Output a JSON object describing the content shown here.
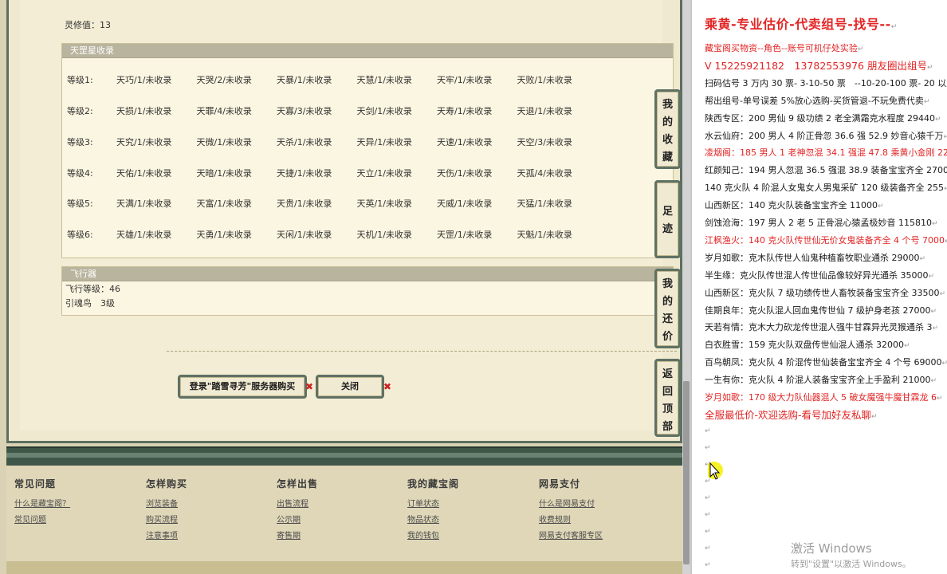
{
  "game": {
    "lingxiu_label": "灵修值：13",
    "stars_header": "天罡星收录",
    "star_rows": [
      {
        "level": "等级1:",
        "cells": [
          "天巧/1/未收录",
          "天哭/2/未收录",
          "天暴/1/未收录",
          "天慧/1/未收录",
          "天牢/1/未收录",
          "天败/1/未收录"
        ]
      },
      {
        "level": "等级2:",
        "cells": [
          "天损/1/未收录",
          "天罪/4/未收录",
          "天寡/3/未收录",
          "天剑/1/未收录",
          "天寿/1/未收录",
          "天退/1/未收录"
        ]
      },
      {
        "level": "等级3:",
        "cells": [
          "天究/1/未收录",
          "天微/1/未收录",
          "天杀/1/未收录",
          "天异/1/未收录",
          "天速/1/未收录",
          "天空/3/未收录"
        ]
      },
      {
        "level": "等级4:",
        "cells": [
          "天佑/1/未收录",
          "天暗/1/未收录",
          "天捷/1/未收录",
          "天立/1/未收录",
          "天伤/1/未收录",
          "天孤/4/未收录"
        ]
      },
      {
        "level": "等级5:",
        "cells": [
          "天满/1/未收录",
          "天富/1/未收录",
          "天贵/1/未收录",
          "天英/1/未收录",
          "天威/1/未收录",
          "天猛/1/未收录"
        ]
      },
      {
        "level": "等级6:",
        "cells": [
          "天雄/1/未收录",
          "天勇/1/未收录",
          "天闲/1/未收录",
          "天机/1/未收录",
          "天罡/1/未收录",
          "天魁/1/未收录"
        ]
      }
    ],
    "flyer_header": "飞行器",
    "flyer_level": "飞行等级：46",
    "flyer_bird": "引魂鸟　3级",
    "login_button": "登录\"踏雪寻芳\"服务器购买",
    "close_button": "关闭"
  },
  "side_nav": [
    {
      "id": "favorites",
      "label": [
        "我",
        "的",
        "收",
        "藏"
      ]
    },
    {
      "id": "footprints",
      "label": [
        "足",
        "迹"
      ]
    },
    {
      "id": "my-bargain",
      "label": [
        "我",
        "的",
        "还",
        "价"
      ]
    },
    {
      "id": "back-to-top",
      "label": [
        "返",
        "回",
        "顶",
        "部"
      ]
    }
  ],
  "footer": {
    "columns": [
      {
        "title": "常见问题",
        "links": [
          "什么是藏宝阁？",
          "常见问题"
        ]
      },
      {
        "title": "怎样购买",
        "links": [
          "浏览装备",
          "购买流程",
          "注意事项"
        ]
      },
      {
        "title": "怎样出售",
        "links": [
          "出售流程",
          "公示期",
          "寄售期"
        ]
      },
      {
        "title": "我的藏宝阁",
        "links": [
          "订单状态",
          "物品状态",
          "我的钱包"
        ]
      },
      {
        "title": "网易支付",
        "links": [
          "什么是网易支付",
          "收费规则",
          "网易支付客服专区"
        ]
      }
    ]
  },
  "doc": {
    "title": "乘黄-专业估价-代卖组号-找号--",
    "lines": [
      {
        "text": "藏宝阁买物资--角色--账号可机仔处实验",
        "red": true
      },
      {
        "text": "V 15225921182　13782553976 朋友圈出组号",
        "red": true,
        "big": true
      },
      {
        "text": "扫码估号 3 万内 30 票- 3-10-50 票　--10-20-100 票- 20 以上 1",
        "red": false
      },
      {
        "text": "帮出组号-单号误差 5%放心选购-买货管退-不玩免费代卖",
        "red": false
      },
      {
        "text": "陕西专区：200 男仙 9 级功绩 2 老全满霜克水程度 29440",
        "red": false
      },
      {
        "text": "水云仙府：200 男人 4 阶正骨忽 36.6 强 52.9 妙音心猿千万",
        "red": false
      },
      {
        "text": "凌烟阁：185 男人 1 老神忽混 34.1 强混 47.8 乘黄小金刚 22",
        "red": true
      },
      {
        "text": "红颜知己：194 男人忽混 36.5 强混 38.9 装备宝宝齐全 2700",
        "red": false
      },
      {
        "text": "140 克火队 4 阶混人女鬼女人男鬼采矿 120 级装备齐全 255",
        "red": false
      },
      {
        "text": "山西新区：140 克火队装备宝宝齐全 11000",
        "red": false
      },
      {
        "text": "剑蚀沧海：197 男人 2 老 5 正骨混心猿孟极妙音 115810",
        "red": false
      },
      {
        "text": "江枫渔火：140 克火队传世仙无价女鬼装备齐全 4 个号 7000",
        "red": true
      },
      {
        "text": "岁月如歌：克木队传世人仙鬼种植畜牧职业通杀 29000",
        "red": false
      },
      {
        "text": "半生缘：克火队传世混人传世仙品像较好异光通杀 35000",
        "red": false
      },
      {
        "text": "山西新区：克火队 7 级功绩传世人畜牧装备宝宝齐全 33500",
        "red": false
      },
      {
        "text": "佳期良年：克火队混人回血鬼传世仙 7 级护身老孩 27000",
        "red": false
      },
      {
        "text": "天若有情：克木大力砍龙传世混人强牛甘霖异光灵猴通杀 3",
        "red": false
      },
      {
        "text": "白衣胜雪：159 克火队双盘传世仙混人通杀 32000",
        "red": false
      },
      {
        "text": "百鸟朝凤：克火队 4 阶混传世仙装备宝宝齐全 4 个号 69000",
        "red": false
      },
      {
        "text": "一生有你：克火队 4 阶混人装备宝宝齐全上手盈利 21000",
        "red": false
      },
      {
        "text": "岁月如歌：170 级大力队仙器混人 5 破女魔强牛魔甘霖龙 6",
        "red": true
      },
      {
        "text": "全服最低价-欢迎选购-看号加好友私聊",
        "red": true,
        "big": true
      }
    ],
    "paragraph_mark": "↵",
    "watermark_title": "激活 Windows",
    "watermark_sub": "转到\"设置\"以激活 Windows。"
  }
}
